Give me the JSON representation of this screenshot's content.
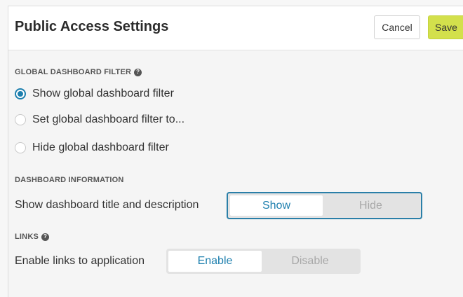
{
  "header": {
    "title": "Public Access Settings",
    "cancel_label": "Cancel",
    "save_label": "Save"
  },
  "global_filter": {
    "section_label": "GLOBAL DASHBOARD FILTER",
    "help_icon": "question-circle-icon",
    "options": [
      {
        "label": "Show global dashboard filter",
        "selected": true
      },
      {
        "label": "Set global dashboard filter to...",
        "selected": false
      },
      {
        "label": "Hide global dashboard filter",
        "selected": false
      }
    ]
  },
  "dashboard_info": {
    "section_label": "DASHBOARD INFORMATION",
    "row_label": "Show dashboard title and description",
    "toggle": {
      "on_label": "Show",
      "off_label": "Hide",
      "selected": "Show"
    }
  },
  "links": {
    "section_label": "LINKS",
    "help_icon": "question-circle-icon",
    "row_label": "Enable links to application",
    "toggle": {
      "on_label": "Enable",
      "off_label": "Disable",
      "selected": "Enable"
    }
  },
  "colors": {
    "accent": "#1d7fae",
    "save_button": "#d3e04c"
  }
}
